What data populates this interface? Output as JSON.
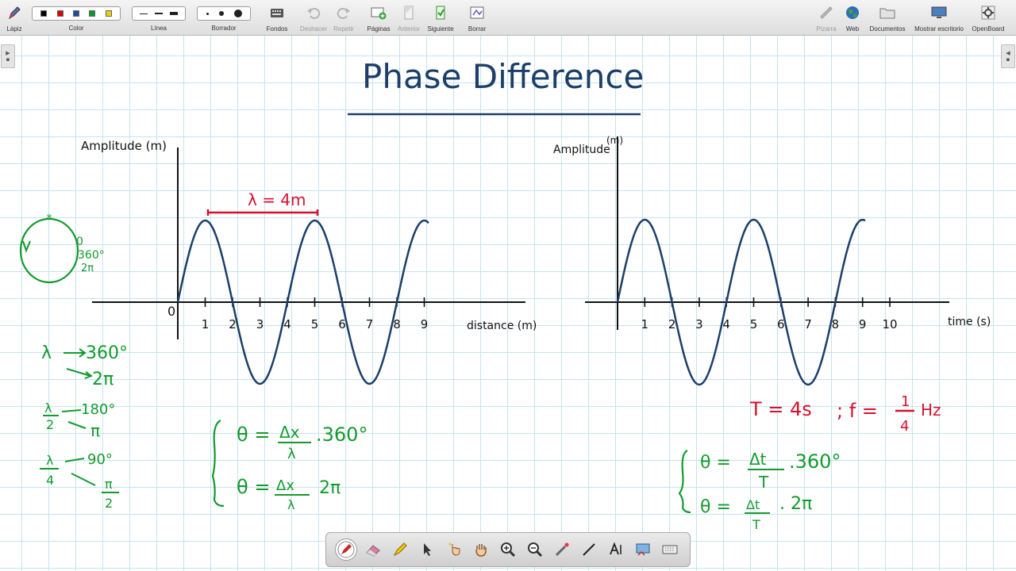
{
  "toolbar": {
    "pen_label": "Lápiz",
    "color_label": "Color",
    "line_label": "Línea",
    "eraser_label": "Borrador",
    "backgrounds_label": "Fondos",
    "undo_label": "Deshacer",
    "redo_label": "Repetir",
    "pages_label": "Páginas",
    "previous_label": "Anterior",
    "next_label": "Siguiente",
    "clear_label": "Borrar",
    "board_label": "Pizarra",
    "web_label": "Web",
    "documents_label": "Documentos",
    "show_desktop_label": "Mostrar escritorio",
    "openboard_label": "OpenBoard",
    "colors": [
      "#000000",
      "#e00000",
      "#1f4e9e",
      "#0a9a2a",
      "#f0d000"
    ]
  },
  "board": {
    "title": "Phase Difference",
    "ink_colors": {
      "blue": "#1b3f6a",
      "black": "#111111",
      "red": "#d8102e",
      "green": "#139a2e"
    },
    "graph_left": {
      "y_label": "Amplitude (m)",
      "x_label": "distance (m)",
      "origin_label": "0",
      "x_ticks": [
        "1",
        "2",
        "3",
        "4",
        "5",
        "6",
        "7",
        "8",
        "9"
      ],
      "wavelength_label": "λ = 4m"
    },
    "graph_right": {
      "y_label": "Amplitude",
      "y_unit": "(m)",
      "x_label": "time (s)",
      "x_ticks": [
        "1",
        "2",
        "3",
        "4",
        "5",
        "6",
        "7",
        "8",
        "9",
        "10"
      ],
      "period_text": "T = 4s",
      "freq_text": "; f =",
      "freq_num": "1",
      "freq_den": "4",
      "freq_unit": "Hz"
    },
    "notes": {
      "circle_zero": "0",
      "circle_deg": "360°",
      "circle_rad": "2π",
      "lambda": "λ",
      "deg360": "360°",
      "rad2pi": "2π",
      "half_num": "λ",
      "half_den": "2",
      "deg180": "180°",
      "pi": "π",
      "quarter_num": "λ",
      "quarter_den": "4",
      "deg90": "90°",
      "pi2_num": "π",
      "pi2_den": "2"
    },
    "formulas_left": {
      "theta": "θ =",
      "num": "Δx",
      "den": "λ",
      "deg_tail": ".360°",
      "rad_tail": "2π"
    },
    "formulas_right": {
      "theta": "θ =",
      "num": "Δt",
      "den": "T",
      "deg_tail": ".360°",
      "rad_tail": ". 2π"
    }
  }
}
